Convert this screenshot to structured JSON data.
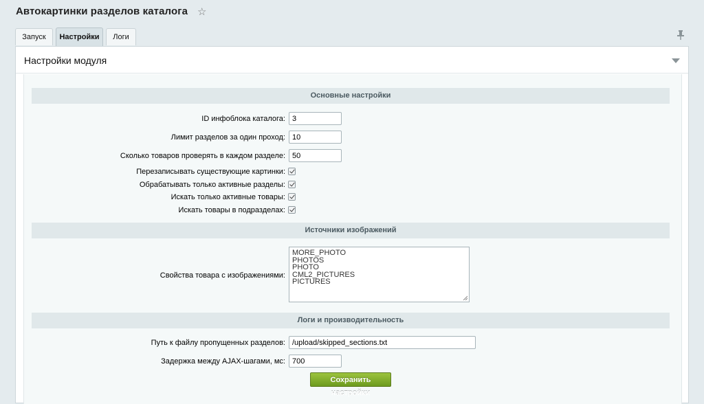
{
  "page": {
    "title": "Автокартинки разделов каталога"
  },
  "tabs": [
    {
      "label": "Запуск",
      "active": false
    },
    {
      "label": "Настройки",
      "active": true
    },
    {
      "label": "Логи",
      "active": false
    }
  ],
  "panel": {
    "title": "Настройки модуля"
  },
  "sections": {
    "main": "Основные настройки",
    "sources": "Источники изображений",
    "logs": "Логи и производительность"
  },
  "fields": {
    "iblock_id": {
      "label": "ID инфоблока каталога:",
      "value": "3"
    },
    "sections_limit": {
      "label": "Лимит разделов за один проход:",
      "value": "10"
    },
    "products_check": {
      "label": "Сколько товаров проверять в каждом разделе:",
      "value": "50"
    },
    "overwrite": {
      "label": "Перезаписывать существующие картинки:",
      "checked": true
    },
    "active_sections": {
      "label": "Обрабатывать только активные разделы:",
      "checked": true
    },
    "active_products": {
      "label": "Искать только активные товары:",
      "checked": true
    },
    "subsections": {
      "label": "Искать товары в подразделах:",
      "checked": true
    },
    "image_props": {
      "label": "Свойства товара с изображениями:",
      "lines": [
        "MORE_PHOTO",
        "PHOTOS",
        "PHOTO",
        "CML2_PICTURES",
        "PICTURES"
      ]
    },
    "skipped_path": {
      "label": "Путь к файлу пропущенных разделов:",
      "value": "/upload/skipped_sections.txt"
    },
    "ajax_delay": {
      "label": "Задержка между AJAX-шагами, мс:",
      "value": "700"
    }
  },
  "actions": {
    "save_label": "Сохранить настройки"
  },
  "icons": {
    "favorite": "star-icon",
    "pin": "pin-icon",
    "collapse": "chevron-down-icon",
    "check": "checkmark-icon"
  },
  "colors": {
    "background": "#e4ebee",
    "section_header": "#e0e8ea",
    "save_button": "#7ea82a"
  }
}
